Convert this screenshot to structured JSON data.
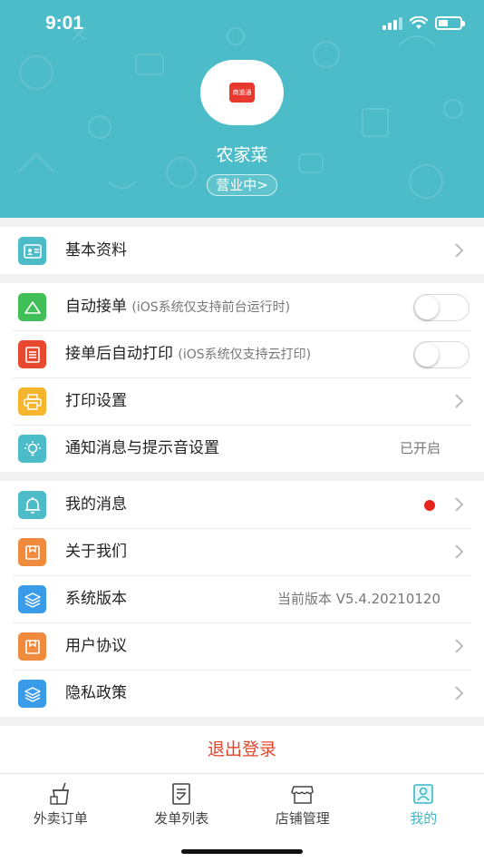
{
  "status_bar": {
    "time": "9:01"
  },
  "header": {
    "logo_text": "商道通",
    "shop_name": "农家菜",
    "business_status": "营业中>"
  },
  "sections": {
    "basic": {
      "label": "基本资料"
    },
    "auto_accept": {
      "label": "自动接单",
      "note": "(iOS系统仅支持前台运行时)",
      "enabled": false
    },
    "auto_print": {
      "label": "接单后自动打印",
      "note": "(iOS系统仅支持云打印)",
      "enabled": false
    },
    "print_settings": {
      "label": "打印设置"
    },
    "notifications": {
      "label": "通知消息与提示音设置",
      "value": "已开启"
    },
    "my_messages": {
      "label": "我的消息"
    },
    "about": {
      "label": "关于我们"
    },
    "version": {
      "label": "系统版本",
      "value": "当前版本 V5.4.20210120"
    },
    "user_agreement": {
      "label": "用户协议"
    },
    "privacy": {
      "label": "隐私政策"
    }
  },
  "logout_label": "退出登录",
  "tabs": [
    {
      "label": "外卖订单",
      "icon": "takeout-icon",
      "active": false
    },
    {
      "label": "发单列表",
      "icon": "list-icon",
      "active": false
    },
    {
      "label": "店铺管理",
      "icon": "store-icon",
      "active": false
    },
    {
      "label": "我的",
      "icon": "profile-icon",
      "active": true
    }
  ],
  "colors": {
    "header_bg": "#4bbcc8",
    "accent": "#3cb8c8",
    "logout_red": "#e3452b",
    "icon_green": "#3fbf55",
    "icon_red": "#e8482d",
    "icon_yellow": "#f6b52d",
    "icon_teal": "#4bbcc8",
    "icon_orange": "#f08a3c",
    "icon_blue": "#3a9be8"
  }
}
